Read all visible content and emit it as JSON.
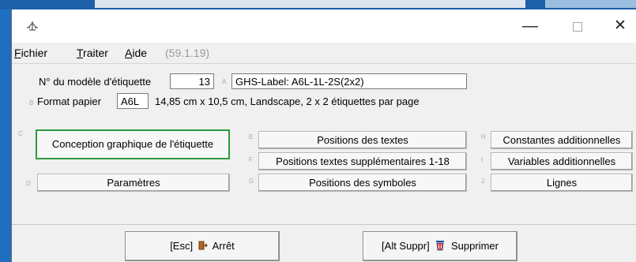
{
  "window": {
    "min_glyph": "—",
    "close_glyph": "✕"
  },
  "menu": {
    "items": [
      {
        "first": "F",
        "rest": "ichier"
      },
      {
        "first": "T",
        "rest": "raiter"
      },
      {
        "first": "A",
        "rest": "ide"
      }
    ],
    "version": "(59.1.19)"
  },
  "model": {
    "label": "N° du modèle d'étiquette",
    "number": "13",
    "hint": "A",
    "name": "GHS-Label: A6L-1L-2S(2x2)"
  },
  "format": {
    "hint": "B",
    "label": "Format papier",
    "value": "A6L",
    "description": "14,85 cm x 10,5 cm, Landscape, 2 x 2 étiquettes par page"
  },
  "buttons": {
    "c": {
      "hint": "C",
      "label": "Conception graphique de l'étiquette"
    },
    "d": {
      "hint": "D",
      "label": "Paramètres"
    },
    "e": {
      "hint": "E",
      "label": "Positions des textes"
    },
    "f": {
      "hint": "F",
      "label": "Positions textes supplémentaires 1-18"
    },
    "g": {
      "hint": "G",
      "label": "Positions des symboles"
    },
    "h": {
      "hint": "H",
      "label": "Constantes additionnelles"
    },
    "i": {
      "hint": "I",
      "label": "Variables additionnelles"
    },
    "j": {
      "hint": "J",
      "label": "Lignes"
    }
  },
  "footer": {
    "stop": {
      "key": "[Esc]",
      "label": "Arrêt"
    },
    "delete": {
      "key": "[Alt Suppr]",
      "label": "Supprimer"
    }
  },
  "colors": {
    "focus": "#2d9a3e",
    "desktop": "#1e6fbf"
  },
  "icons": {
    "app": "app-icon",
    "exit": "exit-door-icon",
    "delete": "trash-icon"
  }
}
